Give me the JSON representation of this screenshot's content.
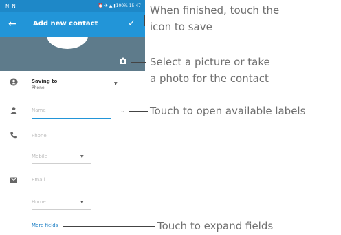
{
  "status_bar": {
    "left": "N N",
    "right": "⏰ ✈ ▲ ▮100% 15:47"
  },
  "app_bar": {
    "title": "Add new contact"
  },
  "form": {
    "saving_to_label": "Saving to",
    "saving_to_value": "Phone",
    "name_placeholder": "Name",
    "phone_placeholder": "Phone",
    "phone_type": "Mobile",
    "email_placeholder": "Email",
    "email_type": "Home",
    "more_fields": "More fields"
  },
  "callouts": {
    "save_line1": "When finished, touch the",
    "save_line2": "icon to save",
    "photo_line1": "Select a picture or take",
    "photo_line2": "a photo for the contact",
    "labels": "Touch to open available labels",
    "expand": "Touch to expand fields"
  },
  "colors": {
    "accent": "#2295d8",
    "status_bar": "#1e88c8",
    "photo_bg": "#5e7b8b",
    "link": "#1b7ec4"
  }
}
